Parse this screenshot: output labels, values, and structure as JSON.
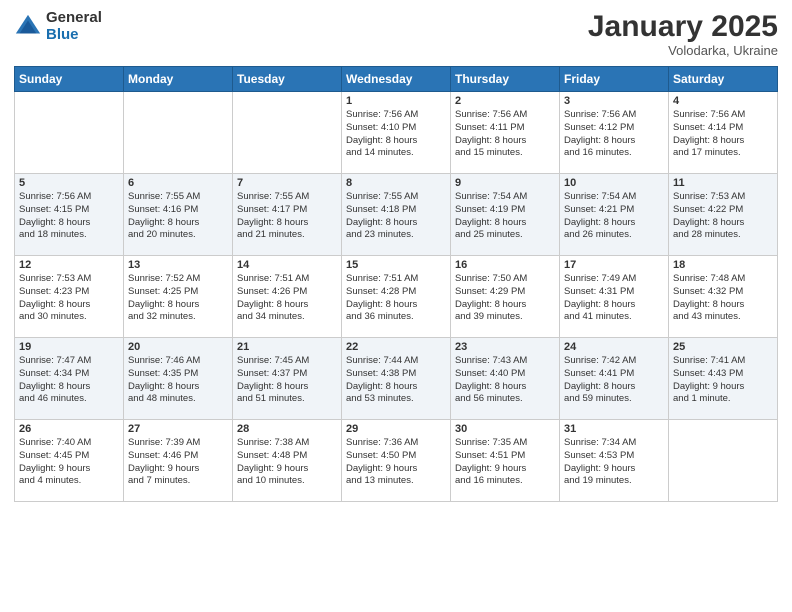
{
  "logo": {
    "general": "General",
    "blue": "Blue"
  },
  "header": {
    "month": "January 2025",
    "location": "Volodarka, Ukraine"
  },
  "weekdays": [
    "Sunday",
    "Monday",
    "Tuesday",
    "Wednesday",
    "Thursday",
    "Friday",
    "Saturday"
  ],
  "weeks": [
    [
      {
        "day": "",
        "info": ""
      },
      {
        "day": "",
        "info": ""
      },
      {
        "day": "",
        "info": ""
      },
      {
        "day": "1",
        "info": "Sunrise: 7:56 AM\nSunset: 4:10 PM\nDaylight: 8 hours\nand 14 minutes."
      },
      {
        "day": "2",
        "info": "Sunrise: 7:56 AM\nSunset: 4:11 PM\nDaylight: 8 hours\nand 15 minutes."
      },
      {
        "day": "3",
        "info": "Sunrise: 7:56 AM\nSunset: 4:12 PM\nDaylight: 8 hours\nand 16 minutes."
      },
      {
        "day": "4",
        "info": "Sunrise: 7:56 AM\nSunset: 4:14 PM\nDaylight: 8 hours\nand 17 minutes."
      }
    ],
    [
      {
        "day": "5",
        "info": "Sunrise: 7:56 AM\nSunset: 4:15 PM\nDaylight: 8 hours\nand 18 minutes."
      },
      {
        "day": "6",
        "info": "Sunrise: 7:55 AM\nSunset: 4:16 PM\nDaylight: 8 hours\nand 20 minutes."
      },
      {
        "day": "7",
        "info": "Sunrise: 7:55 AM\nSunset: 4:17 PM\nDaylight: 8 hours\nand 21 minutes."
      },
      {
        "day": "8",
        "info": "Sunrise: 7:55 AM\nSunset: 4:18 PM\nDaylight: 8 hours\nand 23 minutes."
      },
      {
        "day": "9",
        "info": "Sunrise: 7:54 AM\nSunset: 4:19 PM\nDaylight: 8 hours\nand 25 minutes."
      },
      {
        "day": "10",
        "info": "Sunrise: 7:54 AM\nSunset: 4:21 PM\nDaylight: 8 hours\nand 26 minutes."
      },
      {
        "day": "11",
        "info": "Sunrise: 7:53 AM\nSunset: 4:22 PM\nDaylight: 8 hours\nand 28 minutes."
      }
    ],
    [
      {
        "day": "12",
        "info": "Sunrise: 7:53 AM\nSunset: 4:23 PM\nDaylight: 8 hours\nand 30 minutes."
      },
      {
        "day": "13",
        "info": "Sunrise: 7:52 AM\nSunset: 4:25 PM\nDaylight: 8 hours\nand 32 minutes."
      },
      {
        "day": "14",
        "info": "Sunrise: 7:51 AM\nSunset: 4:26 PM\nDaylight: 8 hours\nand 34 minutes."
      },
      {
        "day": "15",
        "info": "Sunrise: 7:51 AM\nSunset: 4:28 PM\nDaylight: 8 hours\nand 36 minutes."
      },
      {
        "day": "16",
        "info": "Sunrise: 7:50 AM\nSunset: 4:29 PM\nDaylight: 8 hours\nand 39 minutes."
      },
      {
        "day": "17",
        "info": "Sunrise: 7:49 AM\nSunset: 4:31 PM\nDaylight: 8 hours\nand 41 minutes."
      },
      {
        "day": "18",
        "info": "Sunrise: 7:48 AM\nSunset: 4:32 PM\nDaylight: 8 hours\nand 43 minutes."
      }
    ],
    [
      {
        "day": "19",
        "info": "Sunrise: 7:47 AM\nSunset: 4:34 PM\nDaylight: 8 hours\nand 46 minutes."
      },
      {
        "day": "20",
        "info": "Sunrise: 7:46 AM\nSunset: 4:35 PM\nDaylight: 8 hours\nand 48 minutes."
      },
      {
        "day": "21",
        "info": "Sunrise: 7:45 AM\nSunset: 4:37 PM\nDaylight: 8 hours\nand 51 minutes."
      },
      {
        "day": "22",
        "info": "Sunrise: 7:44 AM\nSunset: 4:38 PM\nDaylight: 8 hours\nand 53 minutes."
      },
      {
        "day": "23",
        "info": "Sunrise: 7:43 AM\nSunset: 4:40 PM\nDaylight: 8 hours\nand 56 minutes."
      },
      {
        "day": "24",
        "info": "Sunrise: 7:42 AM\nSunset: 4:41 PM\nDaylight: 8 hours\nand 59 minutes."
      },
      {
        "day": "25",
        "info": "Sunrise: 7:41 AM\nSunset: 4:43 PM\nDaylight: 9 hours\nand 1 minute."
      }
    ],
    [
      {
        "day": "26",
        "info": "Sunrise: 7:40 AM\nSunset: 4:45 PM\nDaylight: 9 hours\nand 4 minutes."
      },
      {
        "day": "27",
        "info": "Sunrise: 7:39 AM\nSunset: 4:46 PM\nDaylight: 9 hours\nand 7 minutes."
      },
      {
        "day": "28",
        "info": "Sunrise: 7:38 AM\nSunset: 4:48 PM\nDaylight: 9 hours\nand 10 minutes."
      },
      {
        "day": "29",
        "info": "Sunrise: 7:36 AM\nSunset: 4:50 PM\nDaylight: 9 hours\nand 13 minutes."
      },
      {
        "day": "30",
        "info": "Sunrise: 7:35 AM\nSunset: 4:51 PM\nDaylight: 9 hours\nand 16 minutes."
      },
      {
        "day": "31",
        "info": "Sunrise: 7:34 AM\nSunset: 4:53 PM\nDaylight: 9 hours\nand 19 minutes."
      },
      {
        "day": "",
        "info": ""
      }
    ]
  ]
}
